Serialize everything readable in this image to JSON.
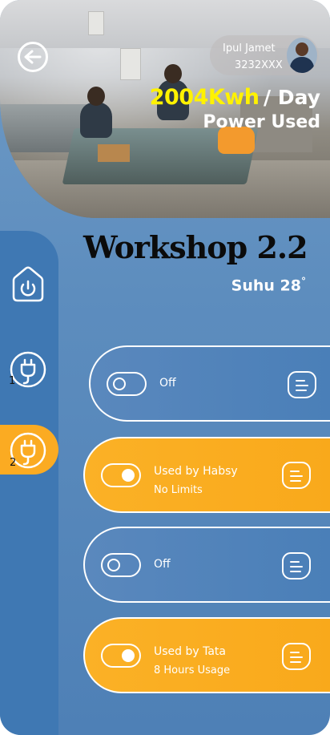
{
  "header": {
    "user_name": "Ipul Jamet",
    "user_id": "3232XXX",
    "power_value": "2004Kwh",
    "power_unit": "/ Day",
    "power_label": "Power Used"
  },
  "room": {
    "title": "Workshop 2.2",
    "temperature_label": "Suhu 28",
    "temperature_unit": "°"
  },
  "sidebar": {
    "items": [
      {
        "icon": "home-power-icon",
        "number": ""
      },
      {
        "icon": "plug-icon",
        "number": "1"
      },
      {
        "icon": "plug-icon",
        "number": "2",
        "active": true
      }
    ]
  },
  "devices": [
    {
      "state": "off",
      "status": "Off",
      "detail": ""
    },
    {
      "state": "on",
      "status": "Used by Habsy",
      "detail": "No Limits"
    },
    {
      "state": "off",
      "status": "Off",
      "detail": ""
    },
    {
      "state": "on",
      "status": "Used by Tata",
      "detail": "8 Hours Usage"
    }
  ],
  "colors": {
    "background_blue": "#4e80b6",
    "sidebar_blue": "#3f78b3",
    "accent_orange": "#fbab22",
    "highlight_yellow": "#fff200",
    "text_white": "#ffffff"
  }
}
